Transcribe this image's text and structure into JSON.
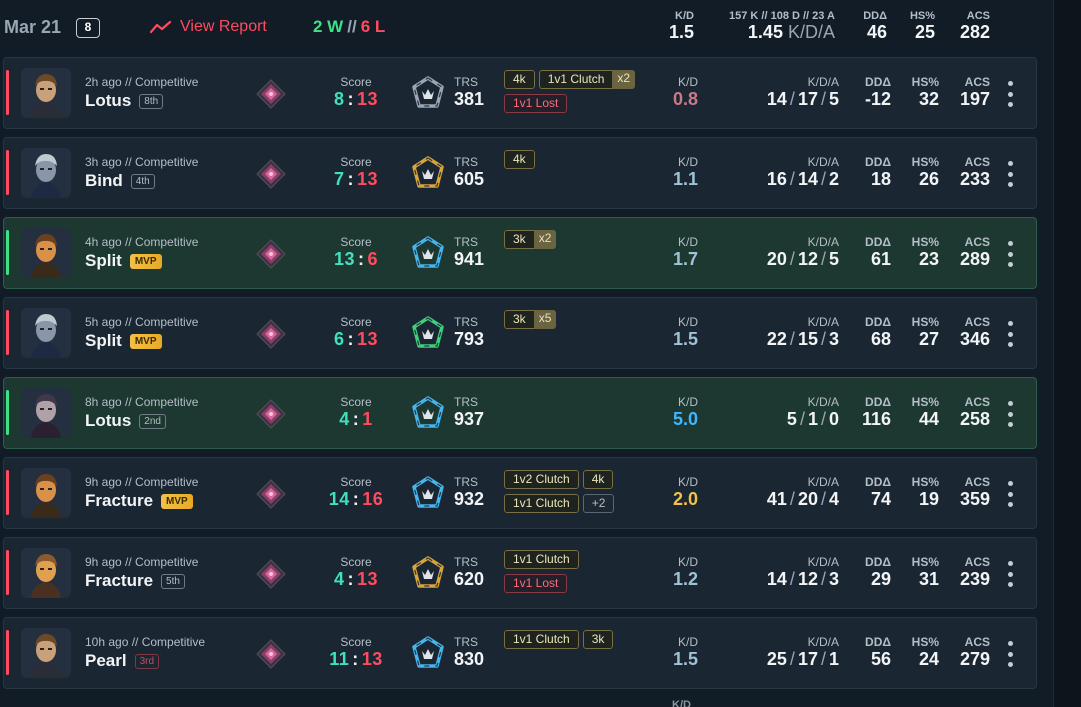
{
  "header": {
    "date": "Mar 21",
    "count": "8",
    "report_label": "View Report",
    "wins": "2 W",
    "sep": "//",
    "losses": "6 L",
    "kd_label": "K/D",
    "kd_value": "1.5",
    "kda_label": "157 K // 108 D // 23 A",
    "kda_value": "1.45",
    "kda_suffix": "K/D/A",
    "dd_label": "DDΔ",
    "dd_value": "46",
    "hs_label": "HS%",
    "hs_value": "25",
    "acs_label": "ACS",
    "acs_value": "282"
  },
  "labels": {
    "score": "Score",
    "trs": "TRS",
    "kd": "K/D",
    "kda": "K/D/A",
    "dd": "DDΔ",
    "hs": "HS%",
    "acs": "ACS",
    "mvp": "MVP"
  },
  "colors": {
    "win": "#3ee088",
    "loss": "#ff4b5f",
    "teal": "#3ee0c0",
    "gold": "#f2c14a",
    "blue_kd": "#3fb6ff"
  },
  "matches": [
    {
      "result": "loss",
      "agent": "chamber",
      "when": "2h ago // Competitive",
      "map": "Lotus",
      "place": "8th",
      "place_style": "normal",
      "mvp": false,
      "score_a": "8",
      "score_b": "13",
      "trs_tier": "silver",
      "trs": "381",
      "badges": [
        [
          {
            "t": "4k"
          },
          {
            "t": "1v1 Clutch",
            "m": "x2"
          }
        ],
        [
          {
            "t": "1v1 Lost",
            "lost": true
          }
        ]
      ],
      "kd": "0.8",
      "kd_color": "#c77a8a",
      "k": "14",
      "d": "17",
      "a": "5",
      "dd": "-12",
      "hs": "32",
      "acs": "197"
    },
    {
      "result": "loss",
      "agent": "neon",
      "when": "3h ago // Competitive",
      "map": "Bind",
      "place": "4th",
      "place_style": "normal",
      "mvp": false,
      "score_a": "7",
      "score_b": "13",
      "trs_tier": "gold",
      "trs": "605",
      "badges": [
        [
          {
            "t": "4k"
          }
        ]
      ],
      "kd": "1.1",
      "kd_color": "#9ec3d6",
      "k": "16",
      "d": "14",
      "a": "2",
      "dd": "18",
      "hs": "26",
      "acs": "233"
    },
    {
      "result": "win",
      "agent": "raze",
      "when": "4h ago // Competitive",
      "map": "Split",
      "place": "MVP",
      "place_style": "mvp",
      "mvp": true,
      "score_a": "13",
      "score_b": "6",
      "trs_tier": "blue",
      "trs": "941",
      "badges": [
        [
          {
            "t": "3k",
            "m": "x2"
          }
        ]
      ],
      "kd": "1.7",
      "kd_color": "#9ec3d6",
      "k": "20",
      "d": "12",
      "a": "5",
      "dd": "61",
      "hs": "23",
      "acs": "289"
    },
    {
      "result": "loss",
      "agent": "neon",
      "when": "5h ago // Competitive",
      "map": "Split",
      "place": "MVP",
      "place_style": "mvp",
      "mvp": true,
      "score_a": "6",
      "score_b": "13",
      "trs_tier": "green",
      "trs": "793",
      "badges": [
        [
          {
            "t": "3k",
            "m": "x5"
          }
        ]
      ],
      "kd": "1.5",
      "kd_color": "#9ec3d6",
      "k": "22",
      "d": "15",
      "a": "3",
      "dd": "68",
      "hs": "27",
      "acs": "346"
    },
    {
      "result": "win",
      "agent": "fade",
      "when": "8h ago // Competitive",
      "map": "Lotus",
      "place": "2nd",
      "place_style": "normal",
      "mvp": false,
      "score_a": "4",
      "score_b": "1",
      "trs_tier": "blue",
      "trs": "937",
      "badges": [],
      "kd": "5.0",
      "kd_color": "#3fb6ff",
      "k": "5",
      "d": "1",
      "a": "0",
      "dd": "116",
      "hs": "44",
      "acs": "258"
    },
    {
      "result": "loss",
      "agent": "raze",
      "when": "9h ago // Competitive",
      "map": "Fracture",
      "place": "MVP",
      "place_style": "mvp",
      "mvp": true,
      "score_a": "14",
      "score_b": "16",
      "trs_tier": "blue",
      "trs": "932",
      "badges": [
        [
          {
            "t": "1v2 Clutch"
          },
          {
            "t": "4k"
          }
        ],
        [
          {
            "t": "1v1 Clutch"
          },
          {
            "t": "+2",
            "plus": true
          }
        ]
      ],
      "kd": "2.0",
      "kd_color": "#f2c14a",
      "k": "41",
      "d": "20",
      "a": "4",
      "dd": "74",
      "hs": "19",
      "acs": "359"
    },
    {
      "result": "loss",
      "agent": "breach",
      "when": "9h ago // Competitive",
      "map": "Fracture",
      "place": "5th",
      "place_style": "normal",
      "mvp": false,
      "score_a": "4",
      "score_b": "13",
      "trs_tier": "gold",
      "trs": "620",
      "badges": [
        [
          {
            "t": "1v1 Clutch"
          }
        ],
        [
          {
            "t": "1v1 Lost",
            "lost": true
          }
        ]
      ],
      "kd": "1.2",
      "kd_color": "#9ec3d6",
      "k": "14",
      "d": "12",
      "a": "3",
      "dd": "29",
      "hs": "31",
      "acs": "239"
    },
    {
      "result": "loss",
      "agent": "chamber",
      "when": "10h ago // Competitive",
      "map": "Pearl",
      "place": "3rd",
      "place_style": "red",
      "mvp": false,
      "score_a": "11",
      "score_b": "13",
      "trs_tier": "blue",
      "trs": "830",
      "badges": [
        [
          {
            "t": "1v1 Clutch"
          },
          {
            "t": "3k"
          }
        ]
      ],
      "kd": "1.5",
      "kd_color": "#9ec3d6",
      "k": "25",
      "d": "17",
      "a": "1",
      "dd": "56",
      "hs": "24",
      "acs": "279"
    }
  ]
}
